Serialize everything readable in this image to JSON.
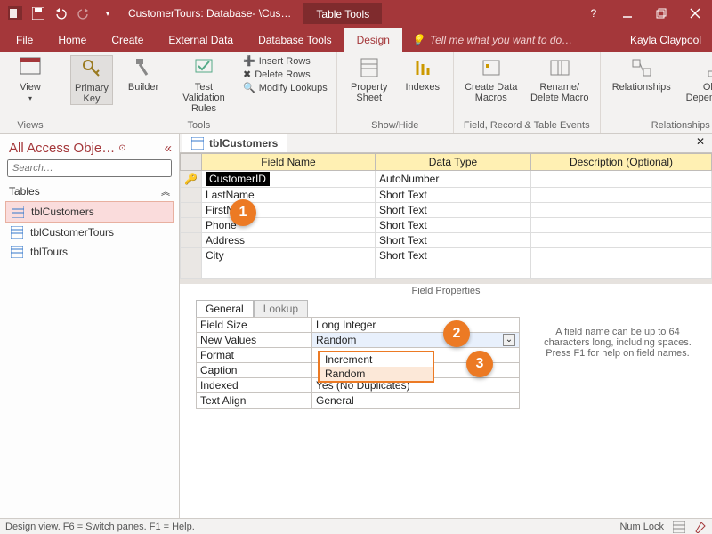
{
  "title": "CustomerTours: Database- \\Cus…",
  "contextual_tab": "Table Tools",
  "user": "Kayla Claypool",
  "tell_me": "Tell me what you want to do…",
  "menu": {
    "file": "File",
    "home": "Home",
    "create": "Create",
    "external": "External Data",
    "dbtools": "Database Tools",
    "design": "Design"
  },
  "ribbon": {
    "views": {
      "view": "View",
      "label": "Views"
    },
    "tools": {
      "pk": "Primary\nKey",
      "builder": "Builder",
      "tvr": "Test Validation\nRules",
      "insert": "Insert Rows",
      "delete": "Delete Rows",
      "modify": "Modify Lookups",
      "label": "Tools"
    },
    "showhide": {
      "ps": "Property\nSheet",
      "idx": "Indexes",
      "label": "Show/Hide"
    },
    "fre": {
      "cdm": "Create Data\nMacros",
      "rdm": "Rename/\nDelete Macro",
      "label": "Field, Record & Table Events"
    },
    "rel": {
      "rel": "Relationships",
      "obj": "Object\nDependencies",
      "label": "Relationships"
    }
  },
  "nav": {
    "header": "All Access Obje…",
    "search_placeholder": "Search…",
    "group": "Tables",
    "items": [
      "tblCustomers",
      "tblCustomerTours",
      "tblTours"
    ]
  },
  "object_tab": "tblCustomers",
  "grid": {
    "headers": {
      "name": "Field Name",
      "type": "Data Type",
      "desc": "Description (Optional)"
    },
    "rows": [
      {
        "pk": true,
        "name": "CustomerID",
        "type": "AutoNumber"
      },
      {
        "name": "LastName",
        "type": "Short Text"
      },
      {
        "name": "FirstName",
        "type": "Short Text"
      },
      {
        "name": "Phone",
        "type": "Short Text"
      },
      {
        "name": "Address",
        "type": "Short Text"
      },
      {
        "name": "City",
        "type": "Short Text"
      }
    ]
  },
  "field_props_label": "Field Properties",
  "prop_tabs": {
    "general": "General",
    "lookup": "Lookup"
  },
  "props": [
    {
      "n": "Field Size",
      "v": "Long Integer"
    },
    {
      "n": "New Values",
      "v": "Random",
      "sel": true
    },
    {
      "n": "Format",
      "v": ""
    },
    {
      "n": "Caption",
      "v": ""
    },
    {
      "n": "Indexed",
      "v": "Yes (No Duplicates)"
    },
    {
      "n": "Text Align",
      "v": "General"
    }
  ],
  "dropdown": [
    "Increment",
    "Random"
  ],
  "tip": "A field name can be up to 64 characters long, including spaces. Press F1 for help on field names.",
  "status": {
    "left": "Design view.  F6 = Switch panes.  F1 = Help.",
    "numlock": "Num Lock"
  },
  "callouts": [
    "1",
    "2",
    "3"
  ]
}
